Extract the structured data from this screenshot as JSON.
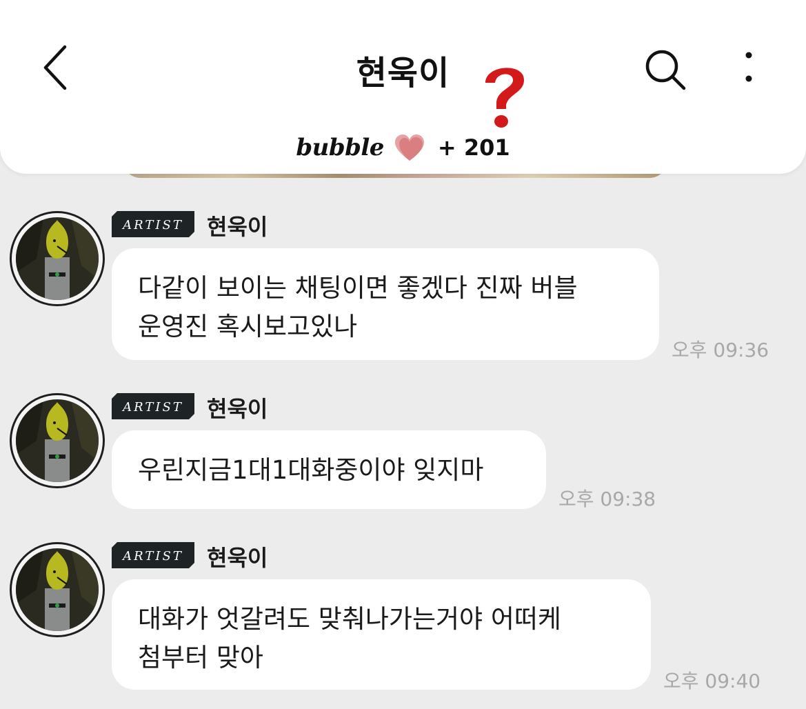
{
  "header": {
    "title": "현욱이",
    "back_icon": "chevron-left-icon",
    "search_icon": "search-icon",
    "more_icon": "more-vertical-icon",
    "annotation": "question-mark-icon",
    "subtitle_brand": "bubble",
    "heart_icon": "heart-icon",
    "plus_count": "+ 201"
  },
  "messages": [
    {
      "badge": "ARTIST",
      "sender": "현욱이",
      "lines": [
        "다같이 보이는 채팅이면 좋겠다 진짜 버블",
        "운영진 혹시보고있나"
      ],
      "time": "오후 09:36"
    },
    {
      "badge": "ARTIST",
      "sender": "현욱이",
      "lines": [
        "우린지금1대1대화중이야 잊지마"
      ],
      "time": "오후 09:38"
    },
    {
      "badge": "ARTIST",
      "sender": "현욱이",
      "lines": [
        "대화가 엇갈려도 맞춰나가는거야 어떠케",
        "첨부터 맞아"
      ],
      "time": "오후 09:40"
    }
  ],
  "colors": {
    "background": "#ececec",
    "bubble": "#ffffff",
    "text": "#1a1a1a",
    "time": "#a8a8a8",
    "badge": "#1e2326",
    "question_mark": "#d21a1a",
    "heart": "#e28a8a"
  }
}
